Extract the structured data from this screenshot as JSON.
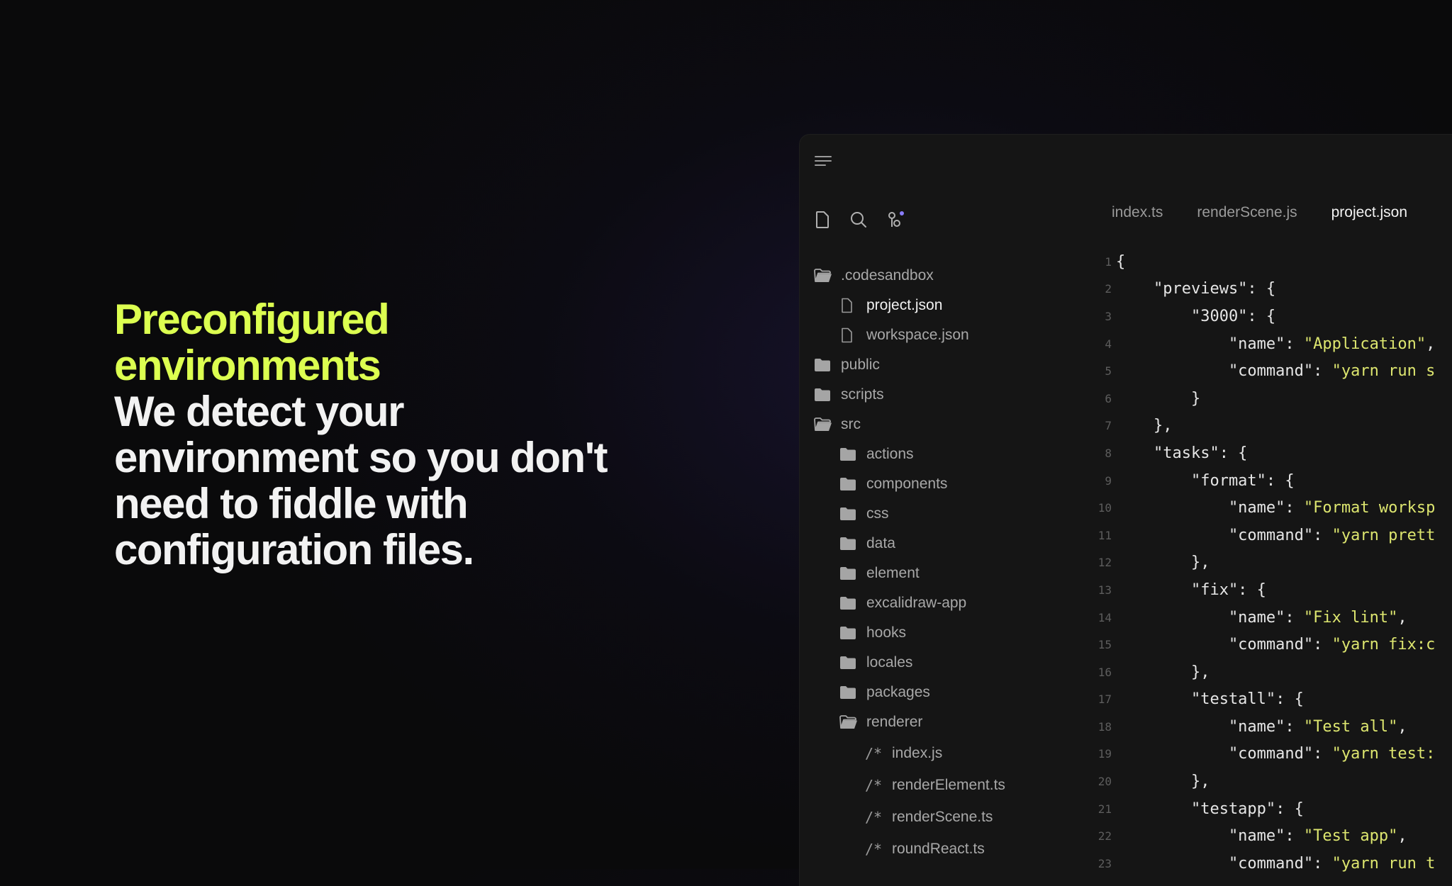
{
  "hero": {
    "title": "Preconfigured environments",
    "description": "We detect your environment so you don't need to fiddle with configuration files."
  },
  "colors": {
    "accent": "#dcff50",
    "string": "#dde66f",
    "background": "#0a0a0b",
    "panel": "#151515"
  },
  "editor": {
    "toolbar_icons": [
      "file-icon",
      "search-icon",
      "git-branch-icon"
    ],
    "tabs": [
      {
        "label": "index.ts",
        "active": false
      },
      {
        "label": "renderScene.js",
        "active": false
      },
      {
        "label": "project.json",
        "active": true
      }
    ],
    "tree": [
      {
        "label": ".codesandbox",
        "icon": "folder-open-icon",
        "level": 0
      },
      {
        "label": "project.json",
        "icon": "file-icon",
        "level": 1,
        "active": true
      },
      {
        "label": "workspace.json",
        "icon": "file-icon",
        "level": 1
      },
      {
        "label": "public",
        "icon": "folder-icon",
        "level": 0
      },
      {
        "label": "scripts",
        "icon": "folder-icon",
        "level": 0
      },
      {
        "label": "src",
        "icon": "folder-open-icon",
        "level": 0
      },
      {
        "label": "actions",
        "icon": "folder-icon",
        "level": 1
      },
      {
        "label": "components",
        "icon": "folder-icon",
        "level": 1
      },
      {
        "label": "css",
        "icon": "folder-icon",
        "level": 1
      },
      {
        "label": "data",
        "icon": "folder-icon",
        "level": 1
      },
      {
        "label": "element",
        "icon": "folder-icon",
        "level": 1
      },
      {
        "label": "excalidraw-app",
        "icon": "folder-icon",
        "level": 1
      },
      {
        "label": "hooks",
        "icon": "folder-icon",
        "level": 1
      },
      {
        "label": "locales",
        "icon": "folder-icon",
        "level": 1
      },
      {
        "label": "packages",
        "icon": "folder-icon",
        "level": 1
      },
      {
        "label": "renderer",
        "icon": "folder-open-icon",
        "level": 1
      },
      {
        "label": "index.js",
        "icon": "comment-file-icon",
        "level": 2
      },
      {
        "label": "renderElement.ts",
        "icon": "comment-file-icon",
        "level": 2
      },
      {
        "label": "renderScene.ts",
        "icon": "comment-file-icon",
        "level": 2
      },
      {
        "label": "roundReact.ts",
        "icon": "comment-file-icon",
        "level": 2
      }
    ],
    "comment_icon_glyph": "/*",
    "code_lines": [
      [
        [
          "p",
          "{"
        ]
      ],
      [
        [
          "p",
          "    \"previews\": {"
        ]
      ],
      [
        [
          "p",
          "        \"3000\": {"
        ]
      ],
      [
        [
          "p",
          "            \"name\": "
        ],
        [
          "s",
          "\"Application\""
        ],
        [
          "p",
          ","
        ]
      ],
      [
        [
          "p",
          "            \"command\": "
        ],
        [
          "s",
          "\"yarn run s"
        ]
      ],
      [
        [
          "p",
          "        }"
        ]
      ],
      [
        [
          "p",
          "    },"
        ]
      ],
      [
        [
          "p",
          "    \"tasks\": {"
        ]
      ],
      [
        [
          "p",
          "        \"format\": {"
        ]
      ],
      [
        [
          "p",
          "            \"name\": "
        ],
        [
          "s",
          "\"Format worksp"
        ]
      ],
      [
        [
          "p",
          "            \"command\": "
        ],
        [
          "s",
          "\"yarn prett"
        ]
      ],
      [
        [
          "p",
          "        },"
        ]
      ],
      [
        [
          "p",
          "        \"fix\": {"
        ]
      ],
      [
        [
          "p",
          "            \"name\": "
        ],
        [
          "s",
          "\"Fix lint\""
        ],
        [
          "p",
          ","
        ]
      ],
      [
        [
          "p",
          "            \"command\": "
        ],
        [
          "s",
          "\"yarn fix:c"
        ]
      ],
      [
        [
          "p",
          "        },"
        ]
      ],
      [
        [
          "p",
          "        \"testall\": {"
        ]
      ],
      [
        [
          "p",
          "            \"name\": "
        ],
        [
          "s",
          "\"Test all\""
        ],
        [
          "p",
          ","
        ]
      ],
      [
        [
          "p",
          "            \"command\": "
        ],
        [
          "s",
          "\"yarn test:"
        ]
      ],
      [
        [
          "p",
          "        },"
        ]
      ],
      [
        [
          "p",
          "        \"testapp\": {"
        ]
      ],
      [
        [
          "p",
          "            \"name\": "
        ],
        [
          "s",
          "\"Test app\""
        ],
        [
          "p",
          ","
        ]
      ],
      [
        [
          "p",
          "            \"command\": "
        ],
        [
          "s",
          "\"yarn run t"
        ]
      ]
    ]
  }
}
